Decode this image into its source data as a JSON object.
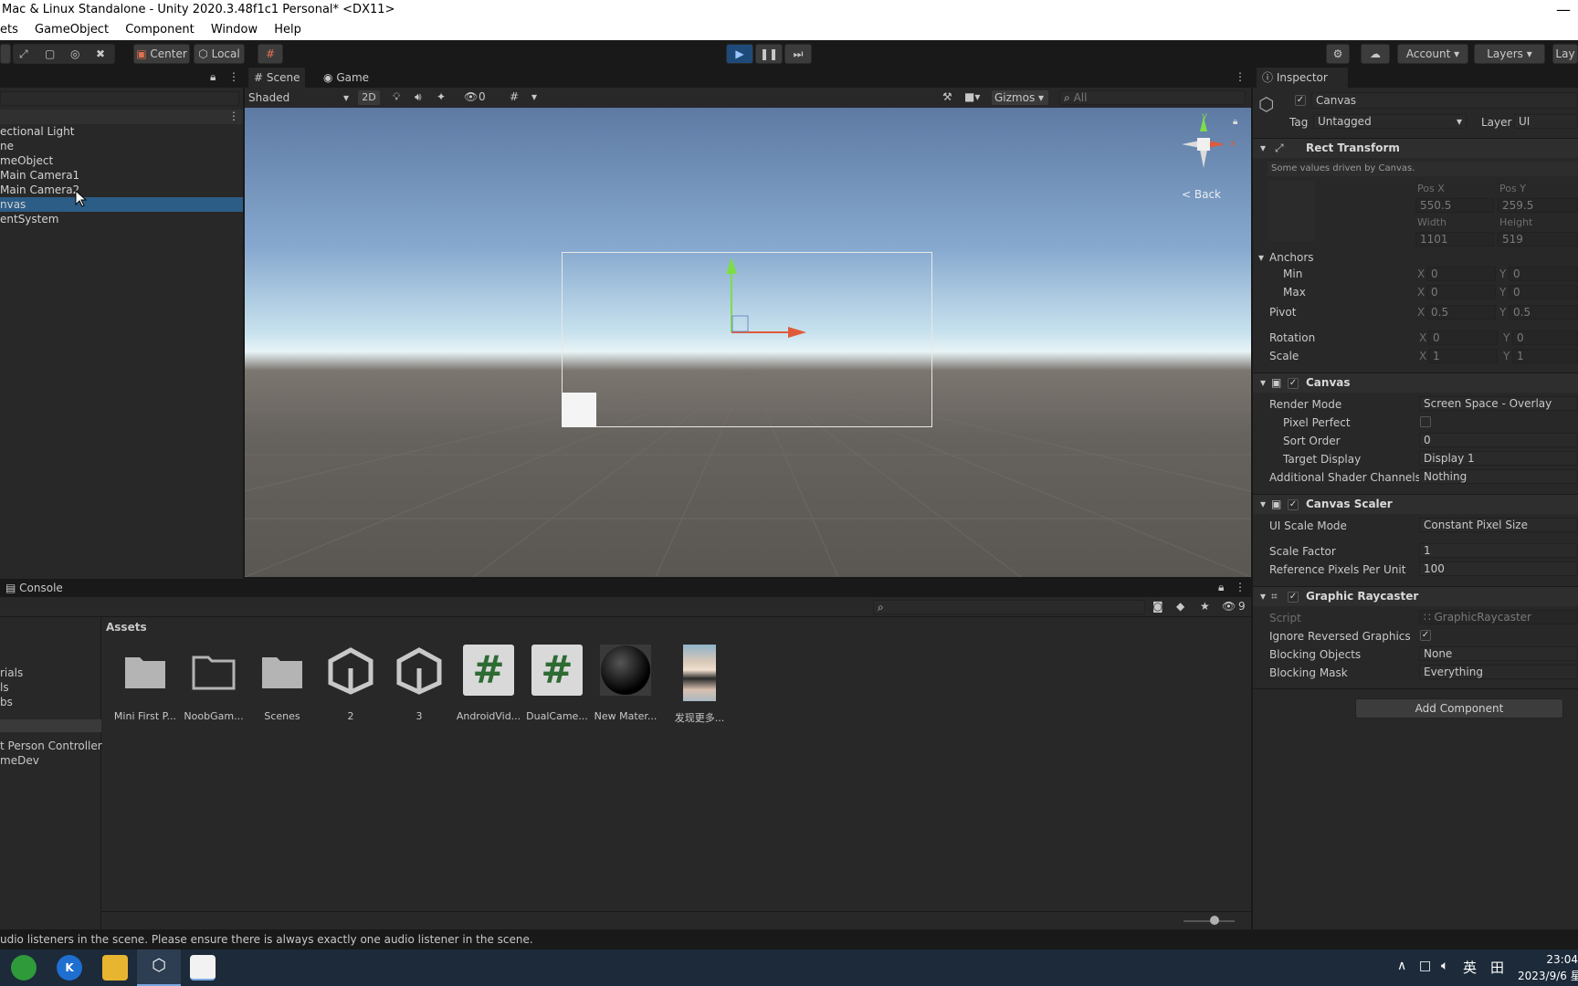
{
  "window": {
    "title": "Mac & Linux Standalone - Unity 2020.3.48f1c1 Personal* <DX11>",
    "close": "—"
  },
  "menu": [
    "ets",
    "GameObject",
    "Component",
    "Window",
    "Help"
  ],
  "toolbar": {
    "center": "Center",
    "local": "Local",
    "account": "Account",
    "layers": "Layers",
    "layout_short": "Lay"
  },
  "hierarchy": {
    "items": [
      "ectional Light",
      "ne",
      "meObject",
      "Main Camera1",
      "Main Camera2",
      "nvas",
      "entSystem"
    ],
    "selected_index": 5
  },
  "scene": {
    "tabs": [
      "Scene",
      "Game"
    ],
    "shading": "Shaded",
    "mode_2d": "2D",
    "hidden_count": "0",
    "gizmos": "Gizmos",
    "search_placeholder": "All",
    "back_label": "< Back",
    "axis_y": "y",
    "axis_x": "x"
  },
  "inspector": {
    "tab": "Inspector",
    "object_name": "Canvas",
    "tag_label": "Tag",
    "tag_value": "Untagged",
    "layer_label": "Layer",
    "layer_value": "UI",
    "rect_transform": {
      "title": "Rect Transform",
      "note": "Some values driven by Canvas.",
      "pos_x_label": "Pos X",
      "pos_y_label": "Pos Y",
      "pos_x": "550.5",
      "pos_y": "259.5",
      "width_label": "Width",
      "height_label": "Height",
      "width": "1101",
      "height": "519",
      "anchors": "Anchors",
      "min": "Min",
      "max": "Max",
      "min_x": "0",
      "min_y": "0",
      "max_x": "0",
      "max_y": "0",
      "pivot": "Pivot",
      "pivot_x": "0.5",
      "pivot_y": "0.5",
      "rotation": "Rotation",
      "rot_x": "0",
      "rot_y": "0",
      "scale": "Scale",
      "scale_x": "1",
      "scale_y": "1",
      "x": "X",
      "y": "Y"
    },
    "canvas": {
      "title": "Canvas",
      "render_mode_label": "Render Mode",
      "render_mode": "Screen Space - Overlay",
      "pixel_perfect_label": "Pixel Perfect",
      "sort_order_label": "Sort Order",
      "sort_order": "0",
      "target_display_label": "Target Display",
      "target_display": "Display 1",
      "shader_channels_label": "Additional Shader Channels",
      "shader_channels": "Nothing"
    },
    "canvas_scaler": {
      "title": "Canvas Scaler",
      "ui_scale_mode_label": "UI Scale Mode",
      "ui_scale_mode": "Constant Pixel Size",
      "scale_factor_label": "Scale Factor",
      "scale_factor": "1",
      "ref_ppu_label": "Reference Pixels Per Unit",
      "ref_ppu": "100"
    },
    "graphic_raycaster": {
      "title": "Graphic Raycaster",
      "script_label": "Script",
      "script": "GraphicRaycaster",
      "ignore_reversed_label": "Ignore Reversed Graphics",
      "blocking_objects_label": "Blocking Objects",
      "blocking_objects": "None",
      "blocking_mask_label": "Blocking Mask",
      "blocking_mask": "Everything"
    },
    "add_component": "Add Component"
  },
  "console": {
    "tab": "Console",
    "hidden_count": "9"
  },
  "project": {
    "folders": [
      "rials",
      "ls",
      "bs",
      "t Person Controller",
      "meDev"
    ],
    "breadcrumb": "Assets",
    "assets": [
      "Mini First P...",
      "NoobGam...",
      "Scenes",
      "2",
      "3",
      "AndroidVid...",
      "DualCame...",
      "New Mater...",
      "发现更多..."
    ]
  },
  "status_bar": "udio listeners in the scene. Please ensure there is always exactly one audio listener in the scene.",
  "taskbar": {
    "time": "23:04",
    "date": "2023/9/6 星",
    "ime": "英",
    "ime_mode": "田"
  }
}
